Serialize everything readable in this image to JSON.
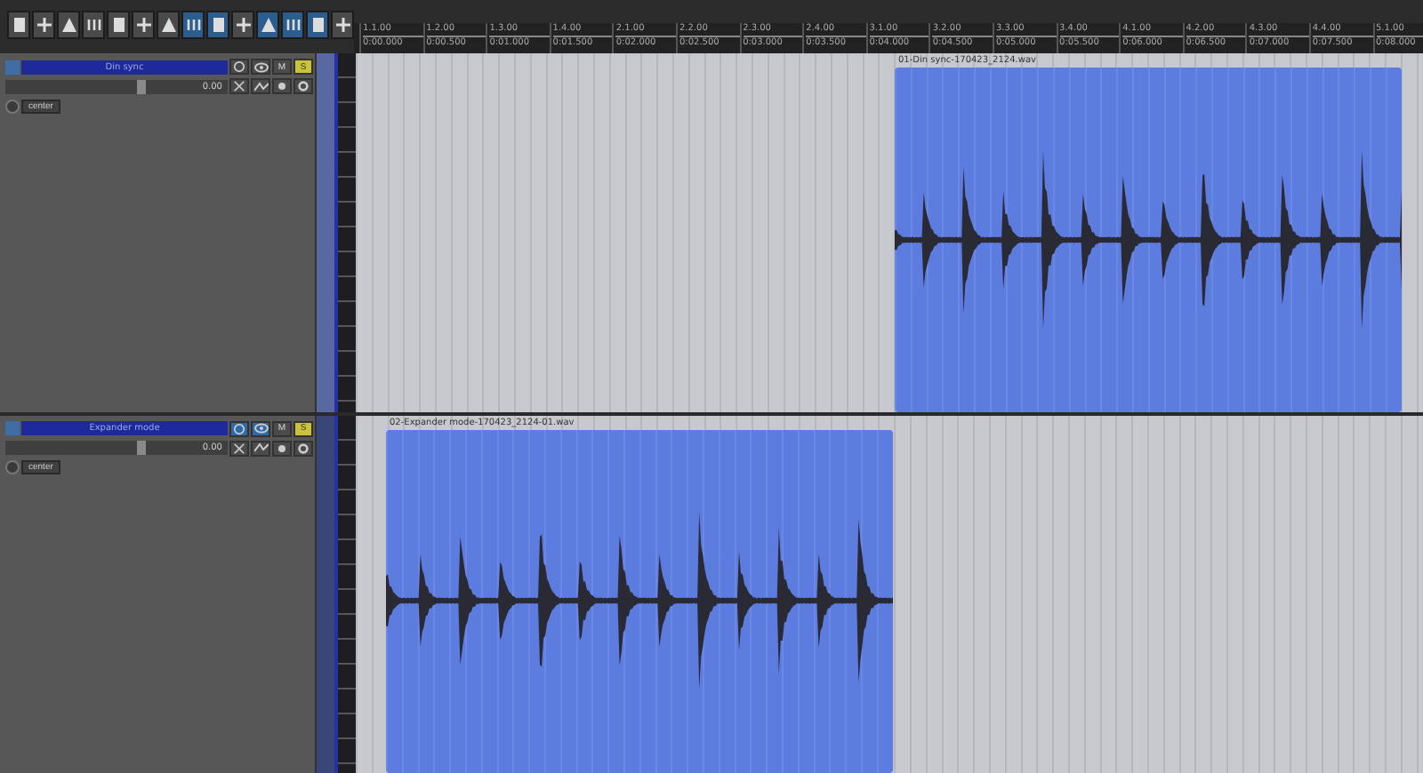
{
  "toolbar": [
    {
      "on": false
    },
    {
      "on": false
    },
    {
      "on": false
    },
    {
      "on": false
    },
    {
      "on": false
    },
    {
      "on": false
    },
    {
      "on": false
    },
    {
      "on": true
    },
    {
      "on": true
    },
    {
      "on": false
    },
    {
      "on": true
    },
    {
      "on": true
    },
    {
      "on": true
    },
    {
      "on": false
    }
  ],
  "ruler": [
    {
      "bar": "1.1.00",
      "time": "0:00.000"
    },
    {
      "bar": "1.2.00",
      "time": "0:00.500"
    },
    {
      "bar": "1.3.00",
      "time": "0:01.000"
    },
    {
      "bar": "1.4.00",
      "time": "0:01.500"
    },
    {
      "bar": "2.1.00",
      "time": "0:02.000"
    },
    {
      "bar": "2.2.00",
      "time": "0:02.500"
    },
    {
      "bar": "2.3.00",
      "time": "0:03.000"
    },
    {
      "bar": "2.4.00",
      "time": "0:03.500"
    },
    {
      "bar": "3.1.00",
      "time": "0:04.000"
    },
    {
      "bar": "3.2.00",
      "time": "0:04.500"
    },
    {
      "bar": "3.3.00",
      "time": "0:05.000"
    },
    {
      "bar": "3.4.00",
      "time": "0:05.500"
    },
    {
      "bar": "4.1.00",
      "time": "0:06.000"
    },
    {
      "bar": "4.2.00",
      "time": "0:06.500"
    },
    {
      "bar": "4.3.00",
      "time": "0:07.000"
    },
    {
      "bar": "4.4.00",
      "time": "0:07.500"
    },
    {
      "bar": "5.1.00",
      "time": "0:08.000"
    }
  ],
  "tracks": [
    {
      "name": "Din sync",
      "volume": "0.00",
      "level": 0.62,
      "pan": "center",
      "monitor": false,
      "record": false,
      "mute_label": "M",
      "solo_label": "S",
      "selected": true,
      "clip": {
        "name": "01-Din sync-170423_2124.wav"
      }
    },
    {
      "name": "Expander mode",
      "volume": "0.00",
      "level": 0.62,
      "pan": "center",
      "monitor": true,
      "record": true,
      "mute_label": "M",
      "solo_label": "S",
      "selected": false,
      "clip": {
        "name": "02-Expander mode-170423_2124-01.wav"
      }
    }
  ]
}
